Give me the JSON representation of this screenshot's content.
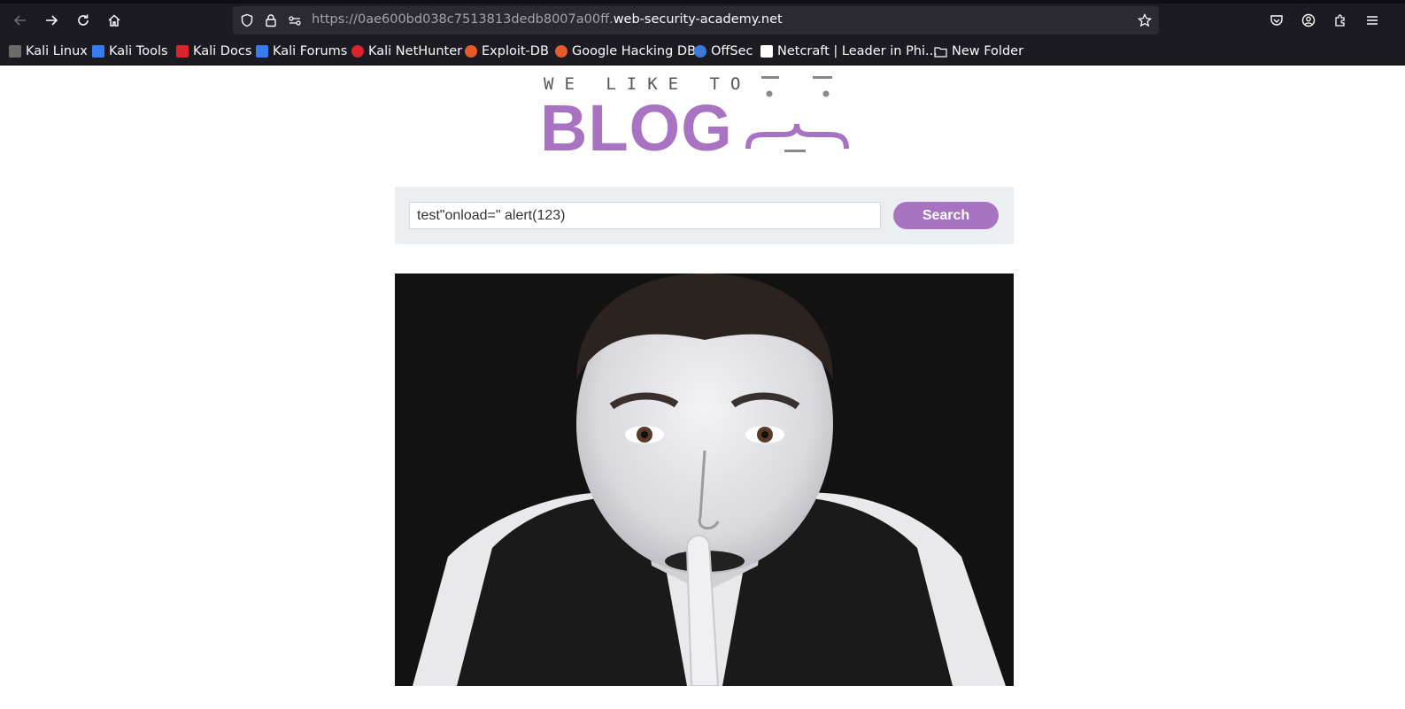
{
  "browser": {
    "url_prefix": "https://0ae600bd038c7513813dedb8007a00ff.",
    "url_domain": "web-security-academy.net",
    "bookmarks": [
      {
        "label": "Kali Linux",
        "color": "#8a8a8a"
      },
      {
        "label": "Kali Tools",
        "color": "#367bf0"
      },
      {
        "label": "Kali Docs",
        "color": "#d9232d"
      },
      {
        "label": "Kali Forums",
        "color": "#367bf0"
      },
      {
        "label": "Kali NetHunter",
        "color": "#d9232d"
      },
      {
        "label": "Exploit-DB",
        "color": "#e8592b"
      },
      {
        "label": "Google Hacking DB",
        "color": "#e8592b"
      },
      {
        "label": "OffSec",
        "color": "#3a7bd5"
      },
      {
        "label": "Netcraft | Leader in Phi...",
        "color": "#ffffff"
      },
      {
        "label": "New Folder",
        "color": "#fbfbfe"
      }
    ]
  },
  "page": {
    "logo_top": "WE LIKE TO",
    "logo_main": "BLOG",
    "search": {
      "value": "test\"onload=\" alert(123)",
      "button_label": "Search"
    },
    "accent_color": "#a874c1"
  }
}
